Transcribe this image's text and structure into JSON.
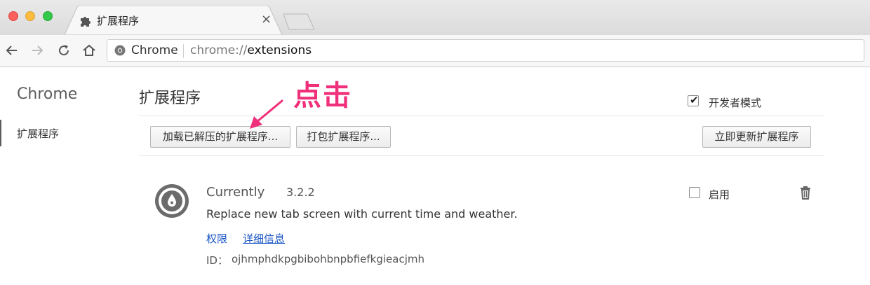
{
  "window": {
    "tab": {
      "title": "扩展程序",
      "icon": "puzzle-piece-icon",
      "close": "×"
    }
  },
  "toolbar": {
    "omnibox": {
      "site_label": "Chrome",
      "url_scheme": "chrome://",
      "url_path": "extensions"
    }
  },
  "sidebar": {
    "title": "Chrome",
    "items": [
      {
        "label": "扩展程序",
        "selected": true
      }
    ]
  },
  "main": {
    "title": "扩展程序",
    "developer_mode": {
      "label": "开发者模式",
      "checked": true
    },
    "buttons": {
      "load_unpacked": "加载已解压的扩展程序...",
      "pack": "打包扩展程序...",
      "update_now": "立即更新扩展程序"
    },
    "annotation": {
      "text": "点击",
      "color": "#f0307a"
    },
    "extensions": [
      {
        "name": "Currently",
        "version": "3.2.2",
        "description": "Replace new tab screen with current time and weather.",
        "permissions_link": "权限",
        "details_link": "详细信息",
        "id_label": "ID：",
        "id": "ojhmphdkpgbibohbnpbfiefkgieacjmh",
        "enabled_label": "启用",
        "enabled": false
      }
    ]
  },
  "colors": {
    "link": "#1a56c4",
    "accent": "#f0307a"
  }
}
